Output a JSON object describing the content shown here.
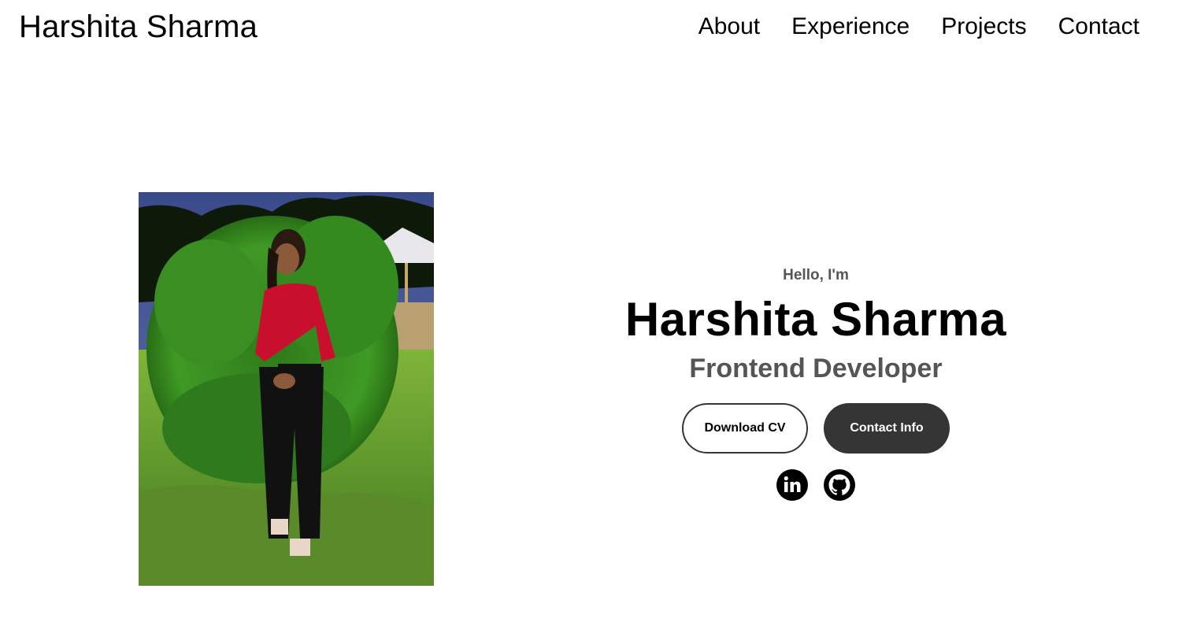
{
  "nav": {
    "logo": "Harshita Sharma",
    "links": [
      {
        "label": "About"
      },
      {
        "label": "Experience"
      },
      {
        "label": "Projects"
      },
      {
        "label": "Contact"
      }
    ]
  },
  "hero": {
    "greeting": "Hello, I'm",
    "name": "Harshita Sharma",
    "role": "Frontend Developer",
    "buttons": {
      "download_cv": "Download CV",
      "contact_info": "Contact Info"
    },
    "socials": [
      {
        "icon": "linkedin-icon"
      },
      {
        "icon": "github-icon"
      }
    ],
    "photo_alt": "profile photo"
  },
  "colors": {
    "text": "#000000",
    "muted": "#555555",
    "dark_button": "#353535",
    "background": "#ffffff"
  }
}
